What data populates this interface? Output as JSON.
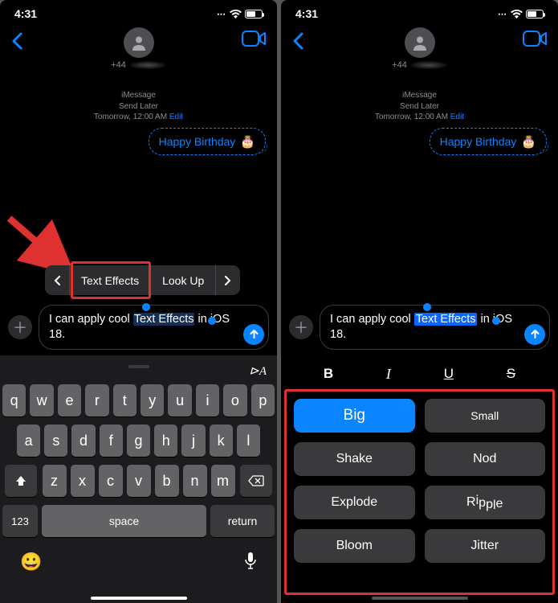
{
  "status": {
    "time": "4:31"
  },
  "contact": {
    "prefix": "+44"
  },
  "sendLater": {
    "app": "iMessage",
    "label": "Send Later",
    "when": "Tomorrow, 12:00 AM",
    "edit": "Edit"
  },
  "scheduledBubble": {
    "text": "Happy Birthday",
    "emoji": "🎂"
  },
  "contextMenu": {
    "textEffects": "Text Effects",
    "lookUp": "Look Up"
  },
  "compose": {
    "pre": "I  can apply cool ",
    "selected": "Text Effects",
    "post": " in iOS 18."
  },
  "keyboard": {
    "row1": [
      "q",
      "w",
      "e",
      "r",
      "t",
      "y",
      "u",
      "i",
      "o",
      "p"
    ],
    "row2": [
      "a",
      "s",
      "d",
      "f",
      "g",
      "h",
      "j",
      "k",
      "l"
    ],
    "row3": [
      "z",
      "x",
      "c",
      "v",
      "b",
      "n",
      "m"
    ],
    "num": "123",
    "space": "space",
    "ret": "return"
  },
  "format": {
    "b": "B",
    "i": "I",
    "u": "U",
    "s": "S"
  },
  "effects": [
    "Big",
    "Small",
    "Shake",
    "Nod",
    "Explode",
    "Ripple",
    "Bloom",
    "Jitter"
  ],
  "colors": {
    "accent": "#0a84ff",
    "annotation": "#e03131"
  }
}
